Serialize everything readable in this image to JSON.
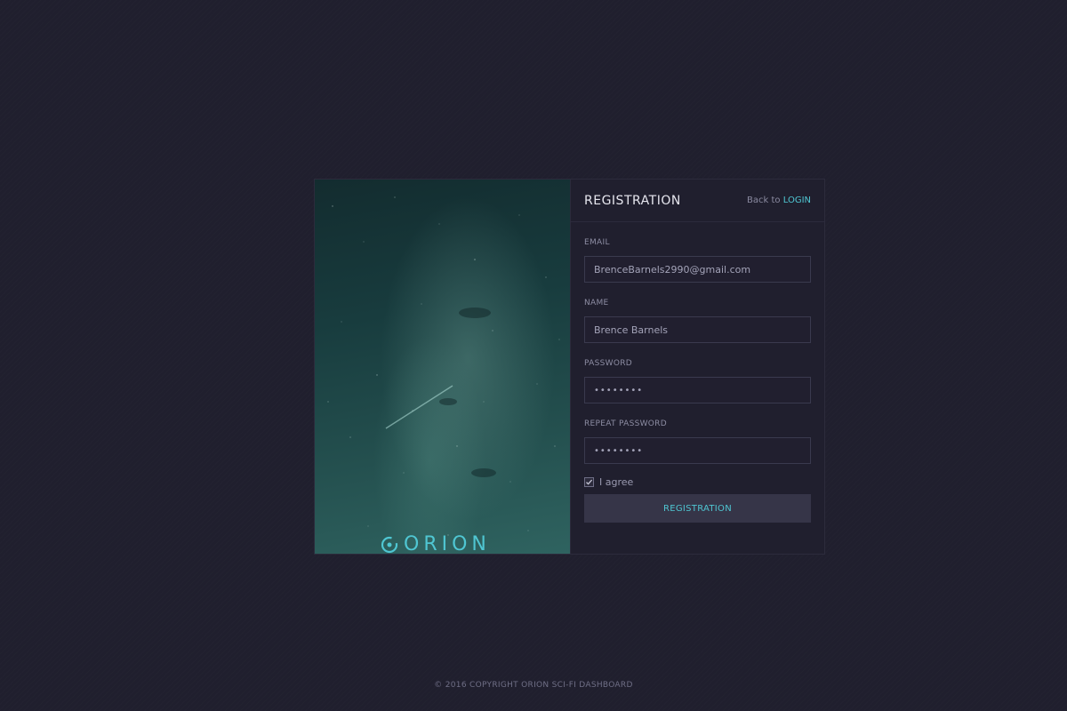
{
  "brand": {
    "logo_text": "ORION",
    "accent": "#4fc6d2"
  },
  "form": {
    "title": "REGISTRATION",
    "back_prefix": "Back to ",
    "back_link": "LOGIN",
    "fields": [
      {
        "label": "EMAIL",
        "value": "BrenceBarnels2990@gmail.com"
      },
      {
        "label": "NAME",
        "value": "Brence Barnels"
      },
      {
        "label": "PASSWORD",
        "value": "••••••••"
      },
      {
        "label": "REPEAT PASSWORD",
        "value": "••••••••"
      }
    ],
    "agree_label": "I agree",
    "agree_checked": true,
    "submit_label": "REGISTRATION"
  },
  "footer": {
    "text": "© 2016 COPYRIGHT ORION SCI-FI DASHBOARD"
  },
  "icons": {
    "logo": "orion-ring-icon",
    "checkbox": "check-icon"
  },
  "colors": {
    "background": "#201f2e",
    "panel_border": "#2c2b3c",
    "input_border": "#3a3a4e",
    "button_bg": "#363548"
  }
}
